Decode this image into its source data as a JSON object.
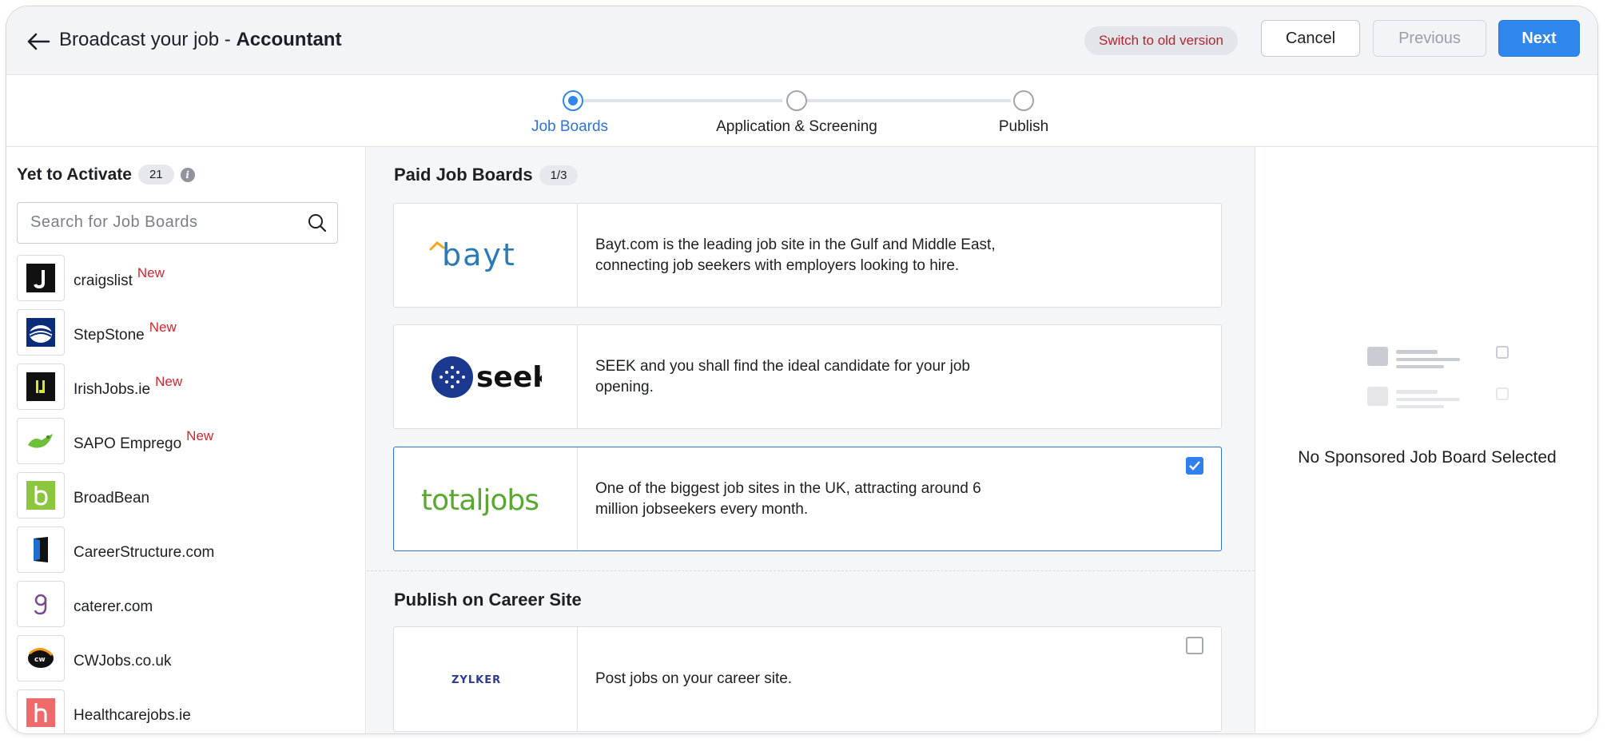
{
  "header": {
    "title_prefix": "Broadcast your job - ",
    "title_job": "Accountant",
    "switch_old_label": "Switch to old version",
    "cancel_label": "Cancel",
    "previous_label": "Previous",
    "next_label": "Next"
  },
  "stepper": {
    "steps": [
      {
        "label": "Job Boards",
        "state": "active"
      },
      {
        "label": "Application & Screening",
        "state": "pending"
      },
      {
        "label": "Publish",
        "state": "pending"
      }
    ]
  },
  "left": {
    "title": "Yet to Activate",
    "count": "21",
    "info_glyph": "i",
    "search_placeholder": "Search for Job Boards",
    "new_label": "New",
    "boards": [
      {
        "name": "craigslist",
        "is_new": true,
        "icon": "craigslist-logo"
      },
      {
        "name": "StepStone",
        "is_new": true,
        "icon": "stepstone-logo"
      },
      {
        "name": "IrishJobs.ie",
        "is_new": true,
        "icon": "irishjobs-logo"
      },
      {
        "name": "SAPO Emprego",
        "is_new": true,
        "icon": "sapo-logo"
      },
      {
        "name": "BroadBean",
        "is_new": false,
        "icon": "broadbean-logo"
      },
      {
        "name": "CareerStructure.com",
        "is_new": false,
        "icon": "careerstructure-logo"
      },
      {
        "name": "caterer.com",
        "is_new": false,
        "icon": "caterer-logo"
      },
      {
        "name": "CWJobs.co.uk",
        "is_new": false,
        "icon": "cwjobs-logo"
      },
      {
        "name": "Healthcarejobs.ie",
        "is_new": false,
        "icon": "healthcarejobs-logo"
      }
    ]
  },
  "center": {
    "paid_title": "Paid Job Boards",
    "paid_count": "1/3",
    "paid_boards": [
      {
        "logo_text": "bayt",
        "description": "Bayt.com is the leading job site in the Gulf and Middle East, connecting job seekers with employers looking to hire.",
        "selected": false
      },
      {
        "logo_text": "seek",
        "description": "SEEK and you shall find the ideal candidate for your job opening.",
        "selected": false
      },
      {
        "logo_text": "totaljobs",
        "description": "One of the biggest job sites in the UK, attracting around 6 million jobseekers every month.",
        "selected": true
      }
    ],
    "career_title": "Publish on Career Site",
    "career_site": {
      "logo_text": "ZYLKER",
      "description": "Post jobs on your career site.",
      "selected": false
    }
  },
  "right": {
    "empty_text": "No Sponsored Job Board Selected"
  },
  "colors": {
    "accent": "#2f86ec",
    "new_tag": "#d8242f",
    "switch_text": "#b0262f"
  }
}
